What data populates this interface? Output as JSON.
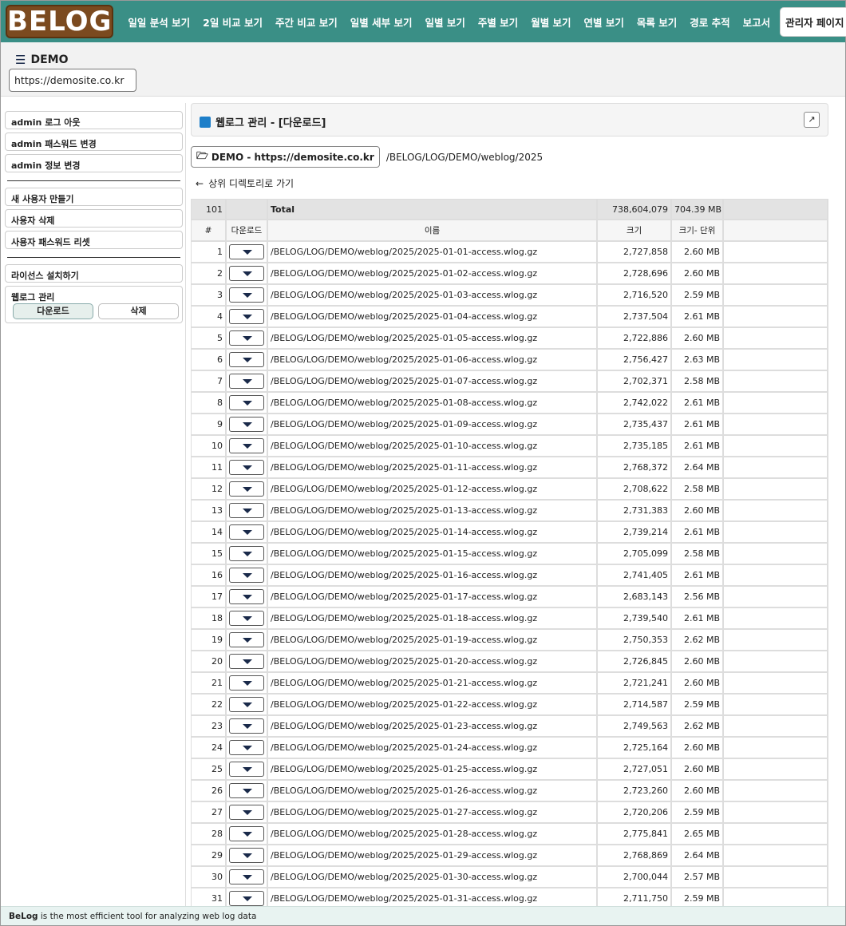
{
  "logo": {
    "text": "BELOG"
  },
  "nav": [
    {
      "label": "일일 분석 보기"
    },
    {
      "label": "2일 비교 보기"
    },
    {
      "label": "주간 비교 보기"
    },
    {
      "label": "일별 세부 보기"
    },
    {
      "label": "일별 보기"
    },
    {
      "label": "주별 보기"
    },
    {
      "label": "월별 보기"
    },
    {
      "label": "연별 보기"
    },
    {
      "label": "목록 보기"
    },
    {
      "label": "경로 추적"
    },
    {
      "label": "보고서"
    }
  ],
  "nav_active": "관리자 페이지",
  "site": {
    "title": "DEMO",
    "url": "https://demosite.co.kr"
  },
  "sidebar": {
    "logout": "admin 로그 아웃",
    "change_password": "admin 패스워드 변경",
    "change_info": "admin 정보 변경",
    "new_user": "새 사용자 만들기",
    "delete_user": "사용자 삭제",
    "reset_password": "사용자 패스워드 리셋",
    "license": "라이선스 설치하기",
    "weblog_group": "웹로그 관리",
    "download": "다운로드",
    "delete": "삭제"
  },
  "header": {
    "title": "웹로그 관리 - [다운로드]"
  },
  "path": {
    "button": "DEMO - https://demosite.co.kr",
    "dir": "/BELOG/LOG/DEMO/weblog/2025"
  },
  "up_link": "상위 디렉토리로 가기",
  "table": {
    "total": {
      "count": "101",
      "label": "Total",
      "size": "738,604,079",
      "unit": "704.39 MB"
    },
    "headers": {
      "idx": "#",
      "download": "다운로드",
      "name": "이름",
      "size": "크기",
      "unit": "크기- 단위"
    },
    "rows": [
      {
        "idx": "1",
        "name": "/BELOG/LOG/DEMO/weblog/2025/2025-01-01-access.wlog.gz",
        "size": "2,727,858",
        "unit": "2.60 MB"
      },
      {
        "idx": "2",
        "name": "/BELOG/LOG/DEMO/weblog/2025/2025-01-02-access.wlog.gz",
        "size": "2,728,696",
        "unit": "2.60 MB"
      },
      {
        "idx": "3",
        "name": "/BELOG/LOG/DEMO/weblog/2025/2025-01-03-access.wlog.gz",
        "size": "2,716,520",
        "unit": "2.59 MB"
      },
      {
        "idx": "4",
        "name": "/BELOG/LOG/DEMO/weblog/2025/2025-01-04-access.wlog.gz",
        "size": "2,737,504",
        "unit": "2.61 MB"
      },
      {
        "idx": "5",
        "name": "/BELOG/LOG/DEMO/weblog/2025/2025-01-05-access.wlog.gz",
        "size": "2,722,886",
        "unit": "2.60 MB"
      },
      {
        "idx": "6",
        "name": "/BELOG/LOG/DEMO/weblog/2025/2025-01-06-access.wlog.gz",
        "size": "2,756,427",
        "unit": "2.63 MB"
      },
      {
        "idx": "7",
        "name": "/BELOG/LOG/DEMO/weblog/2025/2025-01-07-access.wlog.gz",
        "size": "2,702,371",
        "unit": "2.58 MB"
      },
      {
        "idx": "8",
        "name": "/BELOG/LOG/DEMO/weblog/2025/2025-01-08-access.wlog.gz",
        "size": "2,742,022",
        "unit": "2.61 MB"
      },
      {
        "idx": "9",
        "name": "/BELOG/LOG/DEMO/weblog/2025/2025-01-09-access.wlog.gz",
        "size": "2,735,437",
        "unit": "2.61 MB"
      },
      {
        "idx": "10",
        "name": "/BELOG/LOG/DEMO/weblog/2025/2025-01-10-access.wlog.gz",
        "size": "2,735,185",
        "unit": "2.61 MB"
      },
      {
        "idx": "11",
        "name": "/BELOG/LOG/DEMO/weblog/2025/2025-01-11-access.wlog.gz",
        "size": "2,768,372",
        "unit": "2.64 MB"
      },
      {
        "idx": "12",
        "name": "/BELOG/LOG/DEMO/weblog/2025/2025-01-12-access.wlog.gz",
        "size": "2,708,622",
        "unit": "2.58 MB"
      },
      {
        "idx": "13",
        "name": "/BELOG/LOG/DEMO/weblog/2025/2025-01-13-access.wlog.gz",
        "size": "2,731,383",
        "unit": "2.60 MB"
      },
      {
        "idx": "14",
        "name": "/BELOG/LOG/DEMO/weblog/2025/2025-01-14-access.wlog.gz",
        "size": "2,739,214",
        "unit": "2.61 MB"
      },
      {
        "idx": "15",
        "name": "/BELOG/LOG/DEMO/weblog/2025/2025-01-15-access.wlog.gz",
        "size": "2,705,099",
        "unit": "2.58 MB"
      },
      {
        "idx": "16",
        "name": "/BELOG/LOG/DEMO/weblog/2025/2025-01-16-access.wlog.gz",
        "size": "2,741,405",
        "unit": "2.61 MB"
      },
      {
        "idx": "17",
        "name": "/BELOG/LOG/DEMO/weblog/2025/2025-01-17-access.wlog.gz",
        "size": "2,683,143",
        "unit": "2.56 MB"
      },
      {
        "idx": "18",
        "name": "/BELOG/LOG/DEMO/weblog/2025/2025-01-18-access.wlog.gz",
        "size": "2,739,540",
        "unit": "2.61 MB"
      },
      {
        "idx": "19",
        "name": "/BELOG/LOG/DEMO/weblog/2025/2025-01-19-access.wlog.gz",
        "size": "2,750,353",
        "unit": "2.62 MB"
      },
      {
        "idx": "20",
        "name": "/BELOG/LOG/DEMO/weblog/2025/2025-01-20-access.wlog.gz",
        "size": "2,726,845",
        "unit": "2.60 MB"
      },
      {
        "idx": "21",
        "name": "/BELOG/LOG/DEMO/weblog/2025/2025-01-21-access.wlog.gz",
        "size": "2,721,241",
        "unit": "2.60 MB"
      },
      {
        "idx": "22",
        "name": "/BELOG/LOG/DEMO/weblog/2025/2025-01-22-access.wlog.gz",
        "size": "2,714,587",
        "unit": "2.59 MB"
      },
      {
        "idx": "23",
        "name": "/BELOG/LOG/DEMO/weblog/2025/2025-01-23-access.wlog.gz",
        "size": "2,749,563",
        "unit": "2.62 MB"
      },
      {
        "idx": "24",
        "name": "/BELOG/LOG/DEMO/weblog/2025/2025-01-24-access.wlog.gz",
        "size": "2,725,164",
        "unit": "2.60 MB"
      },
      {
        "idx": "25",
        "name": "/BELOG/LOG/DEMO/weblog/2025/2025-01-25-access.wlog.gz",
        "size": "2,727,051",
        "unit": "2.60 MB"
      },
      {
        "idx": "26",
        "name": "/BELOG/LOG/DEMO/weblog/2025/2025-01-26-access.wlog.gz",
        "size": "2,723,260",
        "unit": "2.60 MB"
      },
      {
        "idx": "27",
        "name": "/BELOG/LOG/DEMO/weblog/2025/2025-01-27-access.wlog.gz",
        "size": "2,720,206",
        "unit": "2.59 MB"
      },
      {
        "idx": "28",
        "name": "/BELOG/LOG/DEMO/weblog/2025/2025-01-28-access.wlog.gz",
        "size": "2,775,841",
        "unit": "2.65 MB"
      },
      {
        "idx": "29",
        "name": "/BELOG/LOG/DEMO/weblog/2025/2025-01-29-access.wlog.gz",
        "size": "2,768,869",
        "unit": "2.64 MB"
      },
      {
        "idx": "30",
        "name": "/BELOG/LOG/DEMO/weblog/2025/2025-01-30-access.wlog.gz",
        "size": "2,700,044",
        "unit": "2.57 MB"
      },
      {
        "idx": "31",
        "name": "/BELOG/LOG/DEMO/weblog/2025/2025-01-31-access.wlog.gz",
        "size": "2,711,750",
        "unit": "2.59 MB"
      }
    ]
  },
  "footer": {
    "brand": "BeLog",
    "text": " is the most efficient tool for analyzing web log data"
  },
  "colors": {
    "topbar": "#3a8f86",
    "logo_bg": "#7b4a1f",
    "accent_blue": "#1e7fc9",
    "footer_bg": "#e8f3f1"
  }
}
